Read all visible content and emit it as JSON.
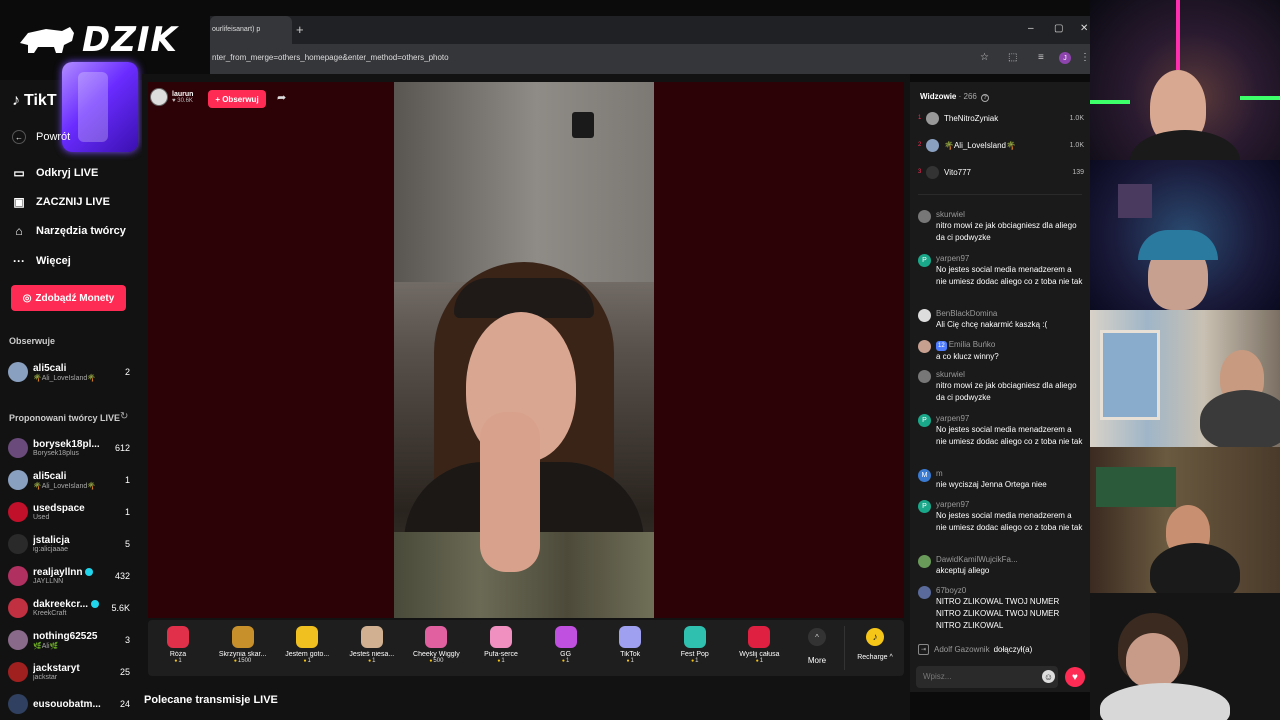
{
  "overlay": {
    "brand": "DZIK"
  },
  "browser": {
    "tab_title": "ourlifeisanart) p",
    "tab_close": "×",
    "new_tab": "+",
    "url": "nter_from_merge=others_homepage&enter_method=others_photo",
    "profile_initial": "J",
    "window_controls": {
      "minimize": "–",
      "maximize": "▢",
      "close": "✕"
    }
  },
  "sidebar": {
    "logo": "TikT",
    "back_label": "Powrót",
    "nav": [
      {
        "label": "Odkryj LIVE",
        "icon": "tv-icon"
      },
      {
        "label": "ZACZNIJ LIVE",
        "icon": "camera-icon"
      },
      {
        "label": "Narzędzia twórcy",
        "icon": "tools-icon"
      },
      {
        "label": "Więcej",
        "icon": "more-icon"
      }
    ],
    "coins_button": "Zdobądź Monety",
    "following_title": "Obserwuje",
    "following": [
      {
        "name": "ali5cali",
        "sub": "🌴Ali_LoveIsland🌴",
        "count": "2",
        "color": "#8aa0c0"
      }
    ],
    "suggested_title": "Proponowani twórcy LIVE",
    "suggested": [
      {
        "name": "borysek18pl...",
        "sub": "Borysek18plus",
        "count": "612",
        "color": "#6a4a7a",
        "verified": false
      },
      {
        "name": "ali5cali",
        "sub": "🌴Ali_LoveIsland🌴",
        "count": "1",
        "color": "#8aa0c0",
        "verified": false
      },
      {
        "name": "usedspace",
        "sub": "Used",
        "count": "1",
        "color": "#c0102a",
        "verified": false
      },
      {
        "name": "jstalicja",
        "sub": "ig:alicjaaae",
        "count": "5",
        "color": "#2a2a2a",
        "verified": false
      },
      {
        "name": "realjayllnn",
        "sub": "JAYLLNN",
        "count": "432",
        "color": "#b03060",
        "verified": true
      },
      {
        "name": "dakreekcr...",
        "sub": "KreekCraft",
        "count": "5.6K",
        "color": "#c03040",
        "verified": true
      },
      {
        "name": "nothing62525",
        "sub": "🌿Ali🌿",
        "count": "3",
        "color": "#8a6a8a",
        "verified": false
      },
      {
        "name": "jackstaryt",
        "sub": "jackstar",
        "count": "25",
        "color": "#a02020",
        "verified": false
      },
      {
        "name": "eusouobatm...",
        "sub": "",
        "count": "24",
        "color": "#304060",
        "verified": false
      }
    ]
  },
  "stream": {
    "host_name": "laurun",
    "host_likes": "♥ 30.6K",
    "follow_button": "+ Obserwuj",
    "recommended_title": "Polecane transmisje LIVE"
  },
  "gifts": [
    {
      "name": "Róża",
      "price": "1",
      "color": "#e0304a"
    },
    {
      "name": "Skrzynia skar...",
      "price": "1500",
      "color": "#c8902a"
    },
    {
      "name": "Jestem goto...",
      "price": "1",
      "color": "#f0c020"
    },
    {
      "name": "Jesteś niesa...",
      "price": "1",
      "color": "#d0b090"
    },
    {
      "name": "Cheeky Wiggly",
      "price": "500",
      "color": "#e060a0"
    },
    {
      "name": "Pufa-serce",
      "price": "1",
      "color": "#f090c0"
    },
    {
      "name": "GG",
      "price": "1",
      "color": "#c050e0"
    },
    {
      "name": "TikTok",
      "price": "1",
      "color": "#a0a0f0"
    },
    {
      "name": "Fest Pop",
      "price": "1",
      "color": "#30c0b0"
    },
    {
      "name": "Wyślij całusa",
      "price": "1",
      "color": "#e02040"
    }
  ],
  "more_label": "More",
  "more_icon": "^",
  "recharge_label": "Recharge ^",
  "recharge_icon": "♪",
  "chat": {
    "viewers_title": "Widzowie",
    "viewers_count": "· 266",
    "top_viewers": [
      {
        "rank": "1",
        "name": "TheNitroZyniak",
        "score": "1.0K",
        "color": "#999"
      },
      {
        "rank": "2",
        "name": "🌴Ali_LoveIsland🌴",
        "score": "1.0K",
        "color": "#8aa0c0"
      },
      {
        "rank": "3",
        "name": "Vito777",
        "score": "139",
        "color": "#333"
      }
    ],
    "messages": [
      {
        "user": "skurwiel",
        "text": "nitro mowi ze jak obciagniesz dla aliego da ci podwyzke",
        "av": "",
        "color": "#777",
        "badge": ""
      },
      {
        "user": "yarpen97",
        "text": "No jestes social media menadzerem a nie umiesz dodac aliego co z toba nie tak",
        "av": "P",
        "color": "#1aa88a",
        "badge": ""
      },
      {
        "user": "BenBlackDomina",
        "text": "Ali Cię chcę nakarmić kaszką :(",
        "av": "",
        "color": "#ddd",
        "badge": ""
      },
      {
        "user": "Emilia Buńko",
        "text": "a co klucz winny?",
        "av": "",
        "color": "#c8a090",
        "badge": "12"
      },
      {
        "user": "skurwiel",
        "text": "nitro mowi ze jak obciagniesz dla aliego da ci podwyzke",
        "av": "",
        "color": "#777",
        "badge": ""
      },
      {
        "user": "yarpen97",
        "text": "No jestes social media menadzerem a nie umiesz dodac aliego co z toba nie tak",
        "av": "P",
        "color": "#1aa88a",
        "badge": ""
      },
      {
        "user": "m",
        "text": "nie wyciszaj Jenna Ortega niee",
        "av": "M",
        "color": "#3a7ad0",
        "badge": ""
      },
      {
        "user": "yarpen97",
        "text": "No jestes social media menadzerem a nie umiesz dodac aliego co z toba nie tak",
        "av": "P",
        "color": "#1aa88a",
        "badge": ""
      },
      {
        "user": "DawidKamilWujcikFa...",
        "text": "akceptuj aliego",
        "av": "",
        "color": "#6a9a5a",
        "badge": ""
      },
      {
        "user": "67boyz0",
        "text": "NITRO ZLIKOWAL TWOJ NUMER NITRO ZLIKOWAL TWOJ NUMER NITRO ZLIKOWAL",
        "av": "",
        "color": "#5a6a9a",
        "badge": ""
      }
    ],
    "join_user": "Adolf Gazownik",
    "join_text": "dołączył(a)",
    "input_placeholder": "Wpisz..."
  }
}
